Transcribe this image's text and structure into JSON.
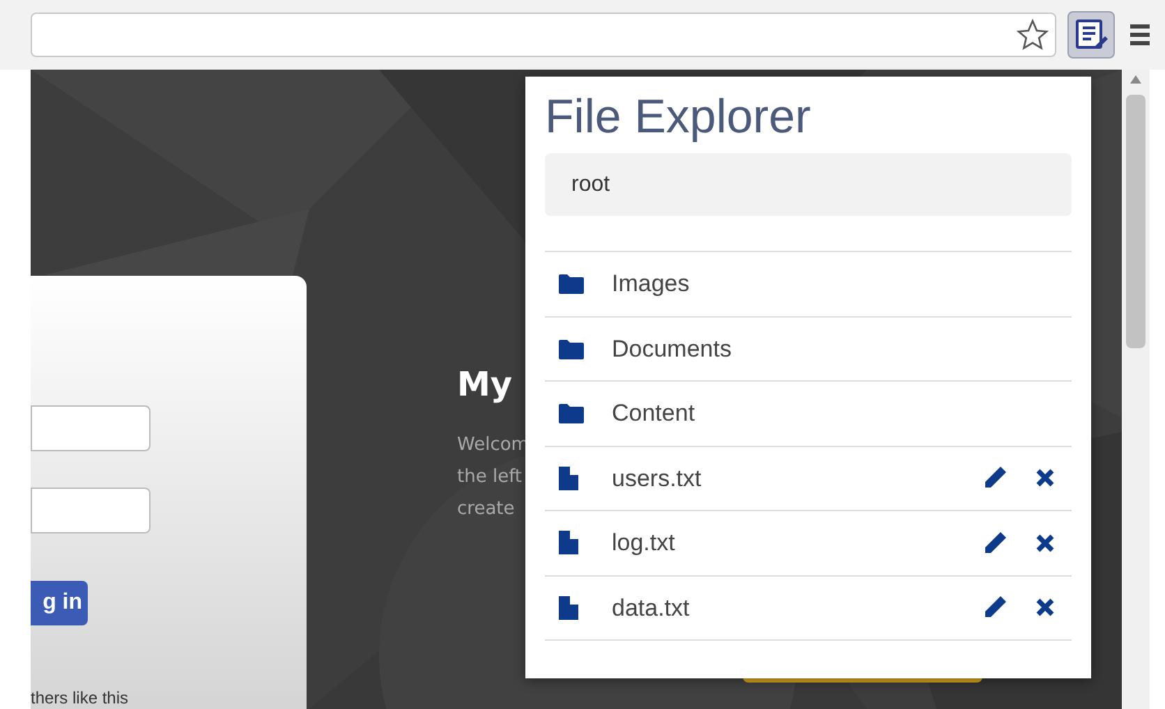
{
  "toolbar": {
    "bookmark_star": {
      "selected": false
    },
    "extension_button": {
      "selected": true
    }
  },
  "page": {
    "login_card": {
      "fields": [
        {
          "kind": "input"
        },
        {
          "kind": "input"
        }
      ],
      "button": "g in",
      "footer": "thers like this"
    },
    "intro": {
      "heading": "My",
      "lines": [
        "Welcom",
        "the left",
        "create"
      ]
    }
  },
  "file_explorer": {
    "title": "File Explorer",
    "path": "root",
    "items": [
      {
        "kind": "folder",
        "name": "Images"
      },
      {
        "kind": "folder",
        "name": "Documents"
      },
      {
        "kind": "folder",
        "name": "Content"
      },
      {
        "kind": "file",
        "name": "users.txt"
      },
      {
        "kind": "file",
        "name": "log.txt"
      },
      {
        "kind": "file",
        "name": "data.txt"
      }
    ]
  }
}
